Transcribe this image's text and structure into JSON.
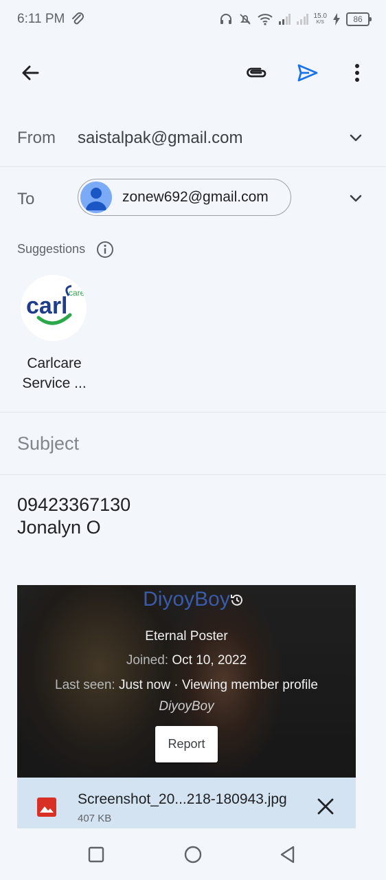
{
  "status_bar": {
    "time": "6:11 PM",
    "net_speed_top": "15.0",
    "net_speed_bottom": "K/S",
    "battery": "86"
  },
  "toolbar": {
    "back_icon": "arrow-left-icon",
    "attach_icon": "paperclip-icon",
    "send_icon": "send-icon",
    "more_icon": "more-vert-icon",
    "send_color": "#1a73e8"
  },
  "compose": {
    "from_label": "From",
    "from_value": "saistalpak@gmail.com",
    "to_label": "To",
    "to_chip": "zonew692@gmail.com",
    "suggestions_label": "Suggestions",
    "suggestion": {
      "name_line1": "Carlcare",
      "name_line2": "Service ..."
    },
    "subject_placeholder": "Subject",
    "body_line1": "09423367130",
    "body_line2": "Jonalyn O"
  },
  "attachment": {
    "preview": {
      "title": "DiyoyBoy",
      "rank": "Eternal Poster",
      "joined_label": "Joined:",
      "joined_value": "Oct 10, 2022",
      "seen_label": "Last seen:",
      "seen_value": "Just now · Viewing member profile",
      "signature": "DiyoyBoy",
      "report_label": "Report"
    },
    "file_name": "Screenshot_20...218-180943.jpg",
    "file_size": "407 KB"
  }
}
